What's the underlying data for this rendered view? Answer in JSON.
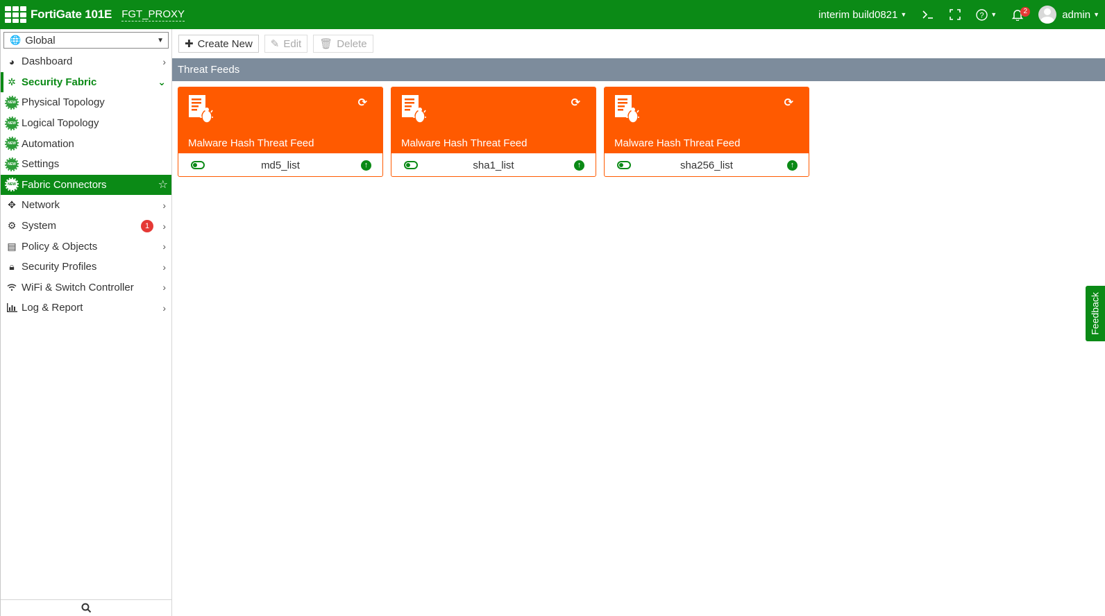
{
  "header": {
    "product": "FortiGate 101E",
    "hostname": "FGT_PROXY",
    "build": "interim build0821",
    "notification_count": "2",
    "user": "admin"
  },
  "sidebar": {
    "vdom": "Global",
    "items": [
      {
        "label": "Dashboard"
      },
      {
        "label": "Security Fabric"
      },
      {
        "label": "Physical Topology"
      },
      {
        "label": "Logical Topology"
      },
      {
        "label": "Automation"
      },
      {
        "label": "Settings"
      },
      {
        "label": "Fabric Connectors"
      },
      {
        "label": "Network"
      },
      {
        "label": "System",
        "badge": "1"
      },
      {
        "label": "Policy & Objects"
      },
      {
        "label": "Security Profiles"
      },
      {
        "label": "WiFi & Switch Controller"
      },
      {
        "label": "Log & Report"
      }
    ]
  },
  "toolbar": {
    "create_new": "Create New",
    "edit": "Edit",
    "delete": "Delete"
  },
  "section": {
    "title": "Threat Feeds"
  },
  "cards": [
    {
      "title": "Malware Hash Threat Feed",
      "name": "md5_list"
    },
    {
      "title": "Malware Hash Threat Feed",
      "name": "sha1_list"
    },
    {
      "title": "Malware Hash Threat Feed",
      "name": "sha256_list"
    }
  ],
  "feedback": "Feedback",
  "colors": {
    "brand_green": "#0b8a16",
    "card_orange": "#ff5a00",
    "section_header": "#7d8c9c"
  }
}
